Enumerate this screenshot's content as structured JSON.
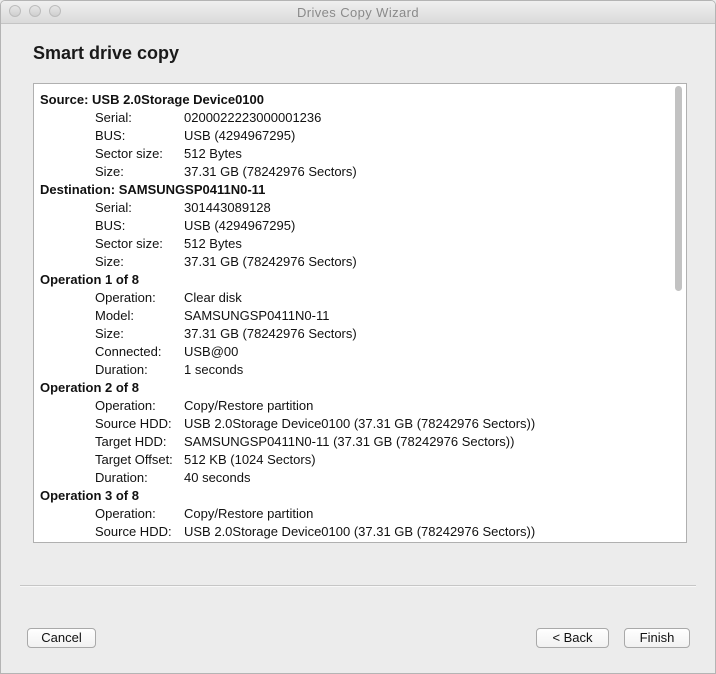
{
  "window": {
    "title": "Drives Copy Wizard"
  },
  "page": {
    "heading": "Smart drive copy"
  },
  "report": {
    "source": {
      "header": "Source: USB 2.0Storage Device0100",
      "rows": [
        {
          "label": "Serial:",
          "value": "0200022223000001236"
        },
        {
          "label": "BUS:",
          "value": "USB (4294967295)"
        },
        {
          "label": "Sector size:",
          "value": "512 Bytes"
        },
        {
          "label": "Size:",
          "value": "37.31 GB (78242976 Sectors)"
        }
      ]
    },
    "destination": {
      "header": "Destination: SAMSUNGSP0411N0-11",
      "rows": [
        {
          "label": "Serial:",
          "value": "301443089128"
        },
        {
          "label": "BUS:",
          "value": "USB (4294967295)"
        },
        {
          "label": "Sector size:",
          "value": "512 Bytes"
        },
        {
          "label": "Size:",
          "value": "37.31 GB (78242976 Sectors)"
        }
      ]
    },
    "operations": [
      {
        "header": "Operation 1 of 8",
        "rows": [
          {
            "label": "Operation:",
            "value": "Clear disk"
          },
          {
            "label": "Model:",
            "value": "SAMSUNGSP0411N0-11"
          },
          {
            "label": "Size:",
            "value": "37.31 GB (78242976 Sectors)"
          },
          {
            "label": "Connected:",
            "value": "USB@00"
          },
          {
            "label": "Duration:",
            "value": "1 seconds"
          }
        ]
      },
      {
        "header": "Operation 2 of 8",
        "rows": [
          {
            "label": "Operation:",
            "value": "Copy/Restore partition"
          },
          {
            "label": "Source HDD:",
            "value": "USB 2.0Storage Device0100 (37.31 GB (78242976 Sectors))"
          },
          {
            "label": "Target HDD:",
            "value": "SAMSUNGSP0411N0-11 (37.31 GB (78242976 Sectors))"
          },
          {
            "label": "Target Offset:",
            "value": "512 KB (1024 Sectors)"
          },
          {
            "label": "Duration:",
            "value": "40 seconds"
          }
        ]
      },
      {
        "header": "Operation 3 of 8",
        "rows": [
          {
            "label": "Operation:",
            "value": "Copy/Restore partition"
          },
          {
            "label": "Source HDD:",
            "value": "USB 2.0Storage Device0100 (37.31 GB (78242976 Sectors))"
          }
        ]
      }
    ]
  },
  "buttons": {
    "cancel": "Cancel",
    "back": "< Back",
    "finish": "Finish"
  }
}
